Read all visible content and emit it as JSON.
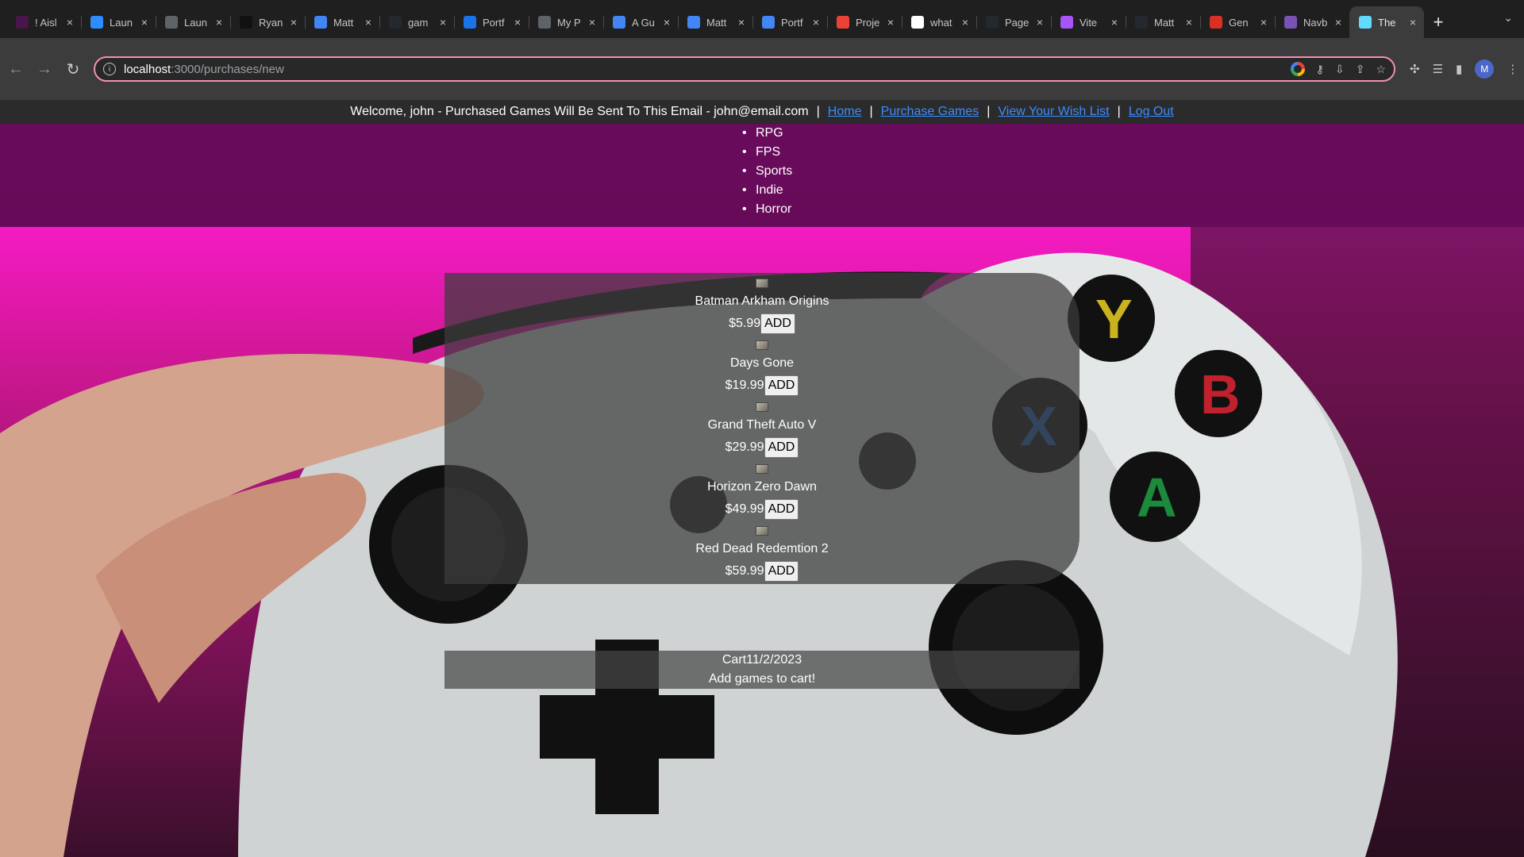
{
  "browser": {
    "tabs": [
      {
        "title": "! Aisl",
        "icon": "slack-icon",
        "color": "#4a154b"
      },
      {
        "title": "Laun",
        "icon": "zoom-icon",
        "color": "#2d8cff"
      },
      {
        "title": "Laun",
        "icon": "globe-icon",
        "color": "#5f6368"
      },
      {
        "title": "Ryan",
        "icon": "rt-icon",
        "color": "#111111"
      },
      {
        "title": "Matt",
        "icon": "docs-icon",
        "color": "#4285f4"
      },
      {
        "title": "gam",
        "icon": "github-icon",
        "color": "#24292f"
      },
      {
        "title": "Portf",
        "icon": "portfolio-icon",
        "color": "#1a73e8"
      },
      {
        "title": "My P",
        "icon": "globe-icon",
        "color": "#5f6368"
      },
      {
        "title": "A Gu",
        "icon": "docs-icon",
        "color": "#4285f4"
      },
      {
        "title": "Matt",
        "icon": "docs-icon",
        "color": "#4285f4"
      },
      {
        "title": "Portf",
        "icon": "docs-icon",
        "color": "#4285f4"
      },
      {
        "title": "Proje",
        "icon": "project-icon",
        "color": "#ea4335"
      },
      {
        "title": "what",
        "icon": "google-icon",
        "color": "#ffffff"
      },
      {
        "title": "Page",
        "icon": "github-icon",
        "color": "#24292f"
      },
      {
        "title": "Vite",
        "icon": "vite-icon",
        "color": "#a855f7"
      },
      {
        "title": "Matt",
        "icon": "github-icon",
        "color": "#24292f"
      },
      {
        "title": "Gen",
        "icon": "gen-icon",
        "color": "#d93025"
      },
      {
        "title": "Navb",
        "icon": "bootstrap-icon",
        "color": "#7952b3"
      },
      {
        "title": "The",
        "icon": "react-icon",
        "color": "#61dafb"
      }
    ],
    "active_tab": 18,
    "url_host": "localhost",
    "url_path": ":3000/purchases/new",
    "profile_initial": "M"
  },
  "nav": {
    "welcome": "Welcome, john - Purchased Games Will Be Sent To This Email - john@email.com",
    "separator": "|",
    "links": [
      "Home",
      "Purchase Games",
      "View Your Wish List",
      "Log Out"
    ]
  },
  "genres": [
    "RPG",
    "FPS",
    "Sports",
    "Indie",
    "Horror"
  ],
  "games": [
    {
      "name": "Batman Arkham Origins",
      "price": "$5.99",
      "button": "ADD"
    },
    {
      "name": "Days Gone",
      "price": "$19.99",
      "button": "ADD"
    },
    {
      "name": "Grand Theft Auto V",
      "price": "$29.99",
      "button": "ADD"
    },
    {
      "name": "Horizon Zero Dawn",
      "price": "$49.99",
      "button": "ADD"
    },
    {
      "name": "Red Dead Redemtion 2",
      "price": "$59.99",
      "button": "ADD"
    }
  ],
  "cart": {
    "title": "Cart",
    "date": "11/2/2023",
    "empty_message": "Add games to cart!"
  }
}
